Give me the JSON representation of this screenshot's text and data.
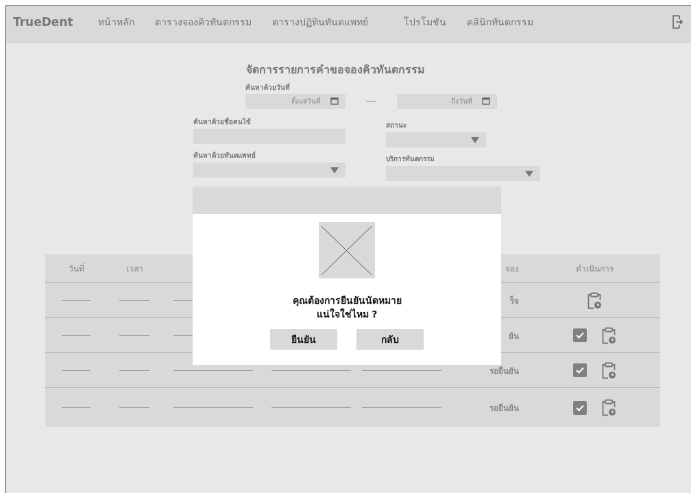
{
  "nav": {
    "brand": "TrueDent",
    "items": [
      {
        "label": "หน้าหลัก"
      },
      {
        "label": "ตารางจองคิวทันตกรรม"
      },
      {
        "label": "ตารางปฏิทินทันตแพทย์"
      },
      {
        "label": "โปรโมชัน"
      },
      {
        "label": "คลินิกทันตกรรม"
      }
    ]
  },
  "title": "จัดการรายการคำขอจองคิวทันตกรรม",
  "filters": {
    "date_label": "ค้นหาด้วยวันที่",
    "date_from": {
      "placeholder": "ตั้งแต่วันที่"
    },
    "date_to": {
      "placeholder": "ถึงวันที่"
    },
    "patient_label": "ค้นหาด้วยชื่อคนไข้",
    "status_label": "สถานะ",
    "dentist_label": "ค้นหาด้วยทันตแพทย์",
    "service_label": "บริการทันตกรรม"
  },
  "table": {
    "columns": [
      "วันที่",
      "เวลา"
    ],
    "status_column": "จอง",
    "actions_column": "ดำเนินการ",
    "rows": [
      {
        "status": "ร็จ",
        "actions": [
          {
            "kind": "history"
          }
        ]
      },
      {
        "status": "ยัน",
        "actions": [
          {
            "kind": "confirm"
          },
          {
            "kind": "history"
          }
        ]
      },
      {
        "status": "รอยืนยัน",
        "actions": [
          {
            "kind": "confirm"
          },
          {
            "kind": "history"
          }
        ]
      },
      {
        "status": "รอยืนยัน",
        "actions": [
          {
            "kind": "confirm"
          },
          {
            "kind": "history"
          }
        ]
      }
    ]
  },
  "modal": {
    "message_lines": [
      "คุณต้องการยืนยันนัดหมาย",
      "แน่ใจใช่ไหม ?"
    ],
    "buttons": [
      "ยืนยัน",
      "กลับ"
    ]
  }
}
